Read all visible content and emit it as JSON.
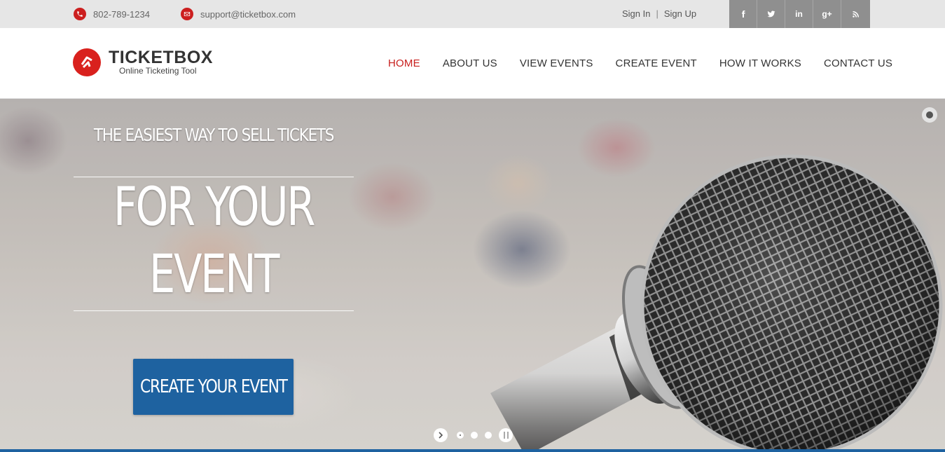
{
  "topbar": {
    "phone": "802-789-1234",
    "email": "support@ticketbox.com",
    "sign_in": "Sign In",
    "separator": "|",
    "sign_up": "Sign Up",
    "social": [
      "facebook-icon",
      "twitter-icon",
      "linkedin-icon",
      "google-plus-icon",
      "rss-icon"
    ],
    "social_glyphs": {
      "linkedin": "in",
      "google_plus": "g+"
    }
  },
  "header": {
    "logo_title": "TICKETBOX",
    "logo_subtitle": "Online Ticketing Tool",
    "nav": [
      {
        "label": "HOME",
        "active": true
      },
      {
        "label": "ABOUT US",
        "active": false
      },
      {
        "label": "VIEW EVENTS",
        "active": false
      },
      {
        "label": "CREATE EVENT",
        "active": false
      },
      {
        "label": "HOW IT WORKS",
        "active": false
      },
      {
        "label": "CONTACT US",
        "active": false
      }
    ]
  },
  "hero": {
    "tagline": "THE EASIEST WAY TO SELL TICKETS",
    "headline_line1": "FOR YOUR",
    "headline_line2": "EVENT",
    "cta_label": "CREATE YOUR EVENT",
    "slides_total": 3,
    "active_slide": 1
  },
  "colors": {
    "brand_red": "#d9211d",
    "nav_active": "#c8201e",
    "cta_blue": "#1e62a0",
    "topbar_bg": "#e6e6e6",
    "social_bg": "#8f8f8f"
  }
}
